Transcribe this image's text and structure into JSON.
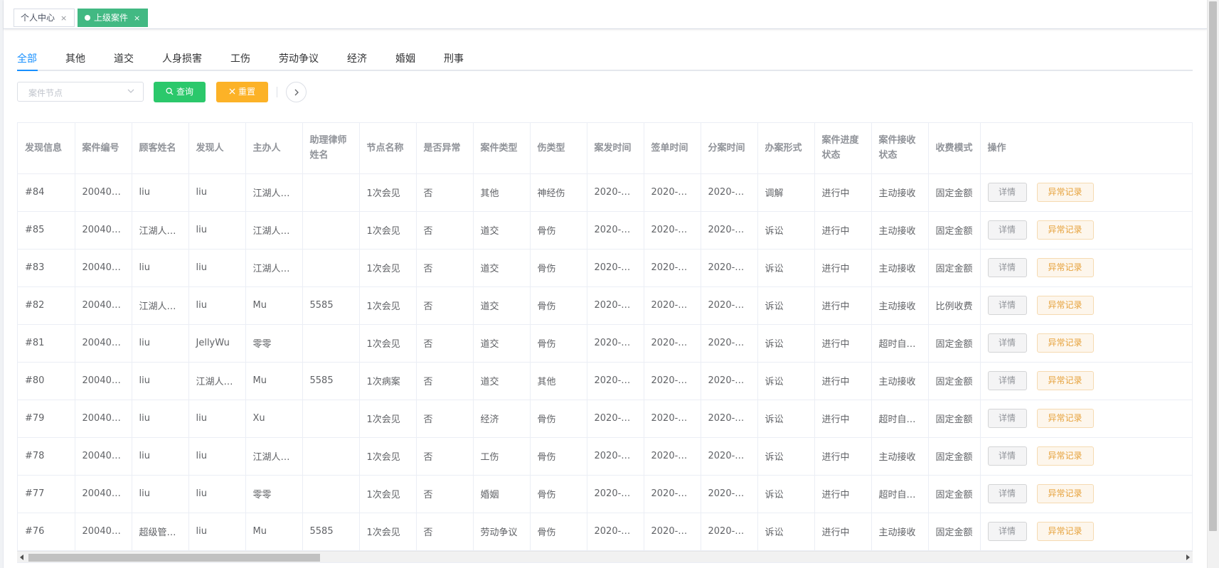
{
  "tags": [
    {
      "label": "个人中心",
      "close": "×",
      "active": false
    },
    {
      "label": "上级案件",
      "close": "×",
      "active": true
    }
  ],
  "tabs": [
    "全部",
    "其他",
    "道交",
    "人身损害",
    "工伤",
    "劳动争议",
    "经济",
    "婚姻",
    "刑事"
  ],
  "active_tab": "全部",
  "filters": {
    "select_placeholder": "案件节点",
    "search_label": "查询",
    "reset_label": "重置"
  },
  "icons": {
    "search": "search-icon",
    "reset": "close-icon",
    "expand": "chevron-right-icon",
    "select": "chevron-down-icon"
  },
  "colors": {
    "primary": "#1890ff",
    "tag_active": "#42b983",
    "search_button": "#2bc86b",
    "reset_button": "#fcb227",
    "anomaly_text": "#e6a23c"
  },
  "table": {
    "headers": [
      "发现信息",
      "案件编号",
      "顾客姓名",
      "发现人",
      "主办人",
      "助理律师姓名",
      "节点名称",
      "是否异常",
      "案件类型",
      "伤类型",
      "案发时间",
      "签单时间",
      "分案时间",
      "办案形式",
      "案件进度状态",
      "案件接收状态",
      "收费模式",
      "操作"
    ],
    "actions": {
      "detail": "详情",
      "anomaly": "异常记录"
    },
    "rows": [
      [
        "#84",
        "20040…",
        "liu",
        "liu",
        "江湖人…",
        "",
        "1次会见",
        "否",
        "其他",
        "神经伤",
        "2020-0…",
        "2020-0…",
        "2020-0…",
        "调解",
        "进行中",
        "主动接收",
        "固定金额"
      ],
      [
        "#85",
        "20040…",
        "江湖人…",
        "liu",
        "江湖人…",
        "",
        "1次会见",
        "否",
        "道交",
        "骨伤",
        "2020-0…",
        "2020-0…",
        "2020-0…",
        "诉讼",
        "进行中",
        "主动接收",
        "固定金额"
      ],
      [
        "#83",
        "20040…",
        "liu",
        "liu",
        "江湖人…",
        "",
        "1次会见",
        "否",
        "道交",
        "骨伤",
        "2020-0…",
        "2020-0…",
        "2020-0…",
        "诉讼",
        "进行中",
        "主动接收",
        "固定金额"
      ],
      [
        "#82",
        "20040…",
        "江湖人…",
        "liu",
        "Mu",
        "5585",
        "1次会见",
        "否",
        "道交",
        "骨伤",
        "2020-0…",
        "2020-0…",
        "2020-0…",
        "诉讼",
        "进行中",
        "主动接收",
        "比例收费"
      ],
      [
        "#81",
        "20040…",
        "liu",
        "JellyWu",
        "零零",
        "",
        "1次会见",
        "否",
        "道交",
        "骨伤",
        "2020-0…",
        "2020-0…",
        "2020-0…",
        "诉讼",
        "进行中",
        "超时自…",
        "固定金额"
      ],
      [
        "#80",
        "20040…",
        "liu",
        "江湖人…",
        "Mu",
        "5585",
        "1次病案",
        "否",
        "道交",
        "其他",
        "2020-0…",
        "2020-0…",
        "2020-0…",
        "诉讼",
        "进行中",
        "主动接收",
        "固定金额"
      ],
      [
        "#79",
        "20040…",
        "liu",
        "liu",
        "Xu",
        "",
        "1次会见",
        "否",
        "经济",
        "骨伤",
        "2020-0…",
        "2020-0…",
        "2020-0…",
        "诉讼",
        "进行中",
        "超时自…",
        "固定金额"
      ],
      [
        "#78",
        "20040…",
        "liu",
        "liu",
        "江湖人…",
        "",
        "1次会见",
        "否",
        "工伤",
        "骨伤",
        "2020-0…",
        "2020-0…",
        "2020-0…",
        "诉讼",
        "进行中",
        "主动接收",
        "固定金额"
      ],
      [
        "#77",
        "20040…",
        "liu",
        "liu",
        "零零",
        "",
        "1次会见",
        "否",
        "婚姻",
        "骨伤",
        "2020-0…",
        "2020-0…",
        "2020-0…",
        "诉讼",
        "进行中",
        "超时自…",
        "固定金额"
      ],
      [
        "#76",
        "20040…",
        "超级管…",
        "liu",
        "Mu",
        "5585",
        "1次会见",
        "否",
        "劳动争议",
        "骨伤",
        "2020-0…",
        "2020-0…",
        "2020-0…",
        "诉讼",
        "进行中",
        "主动接收",
        "固定金额"
      ]
    ]
  }
}
